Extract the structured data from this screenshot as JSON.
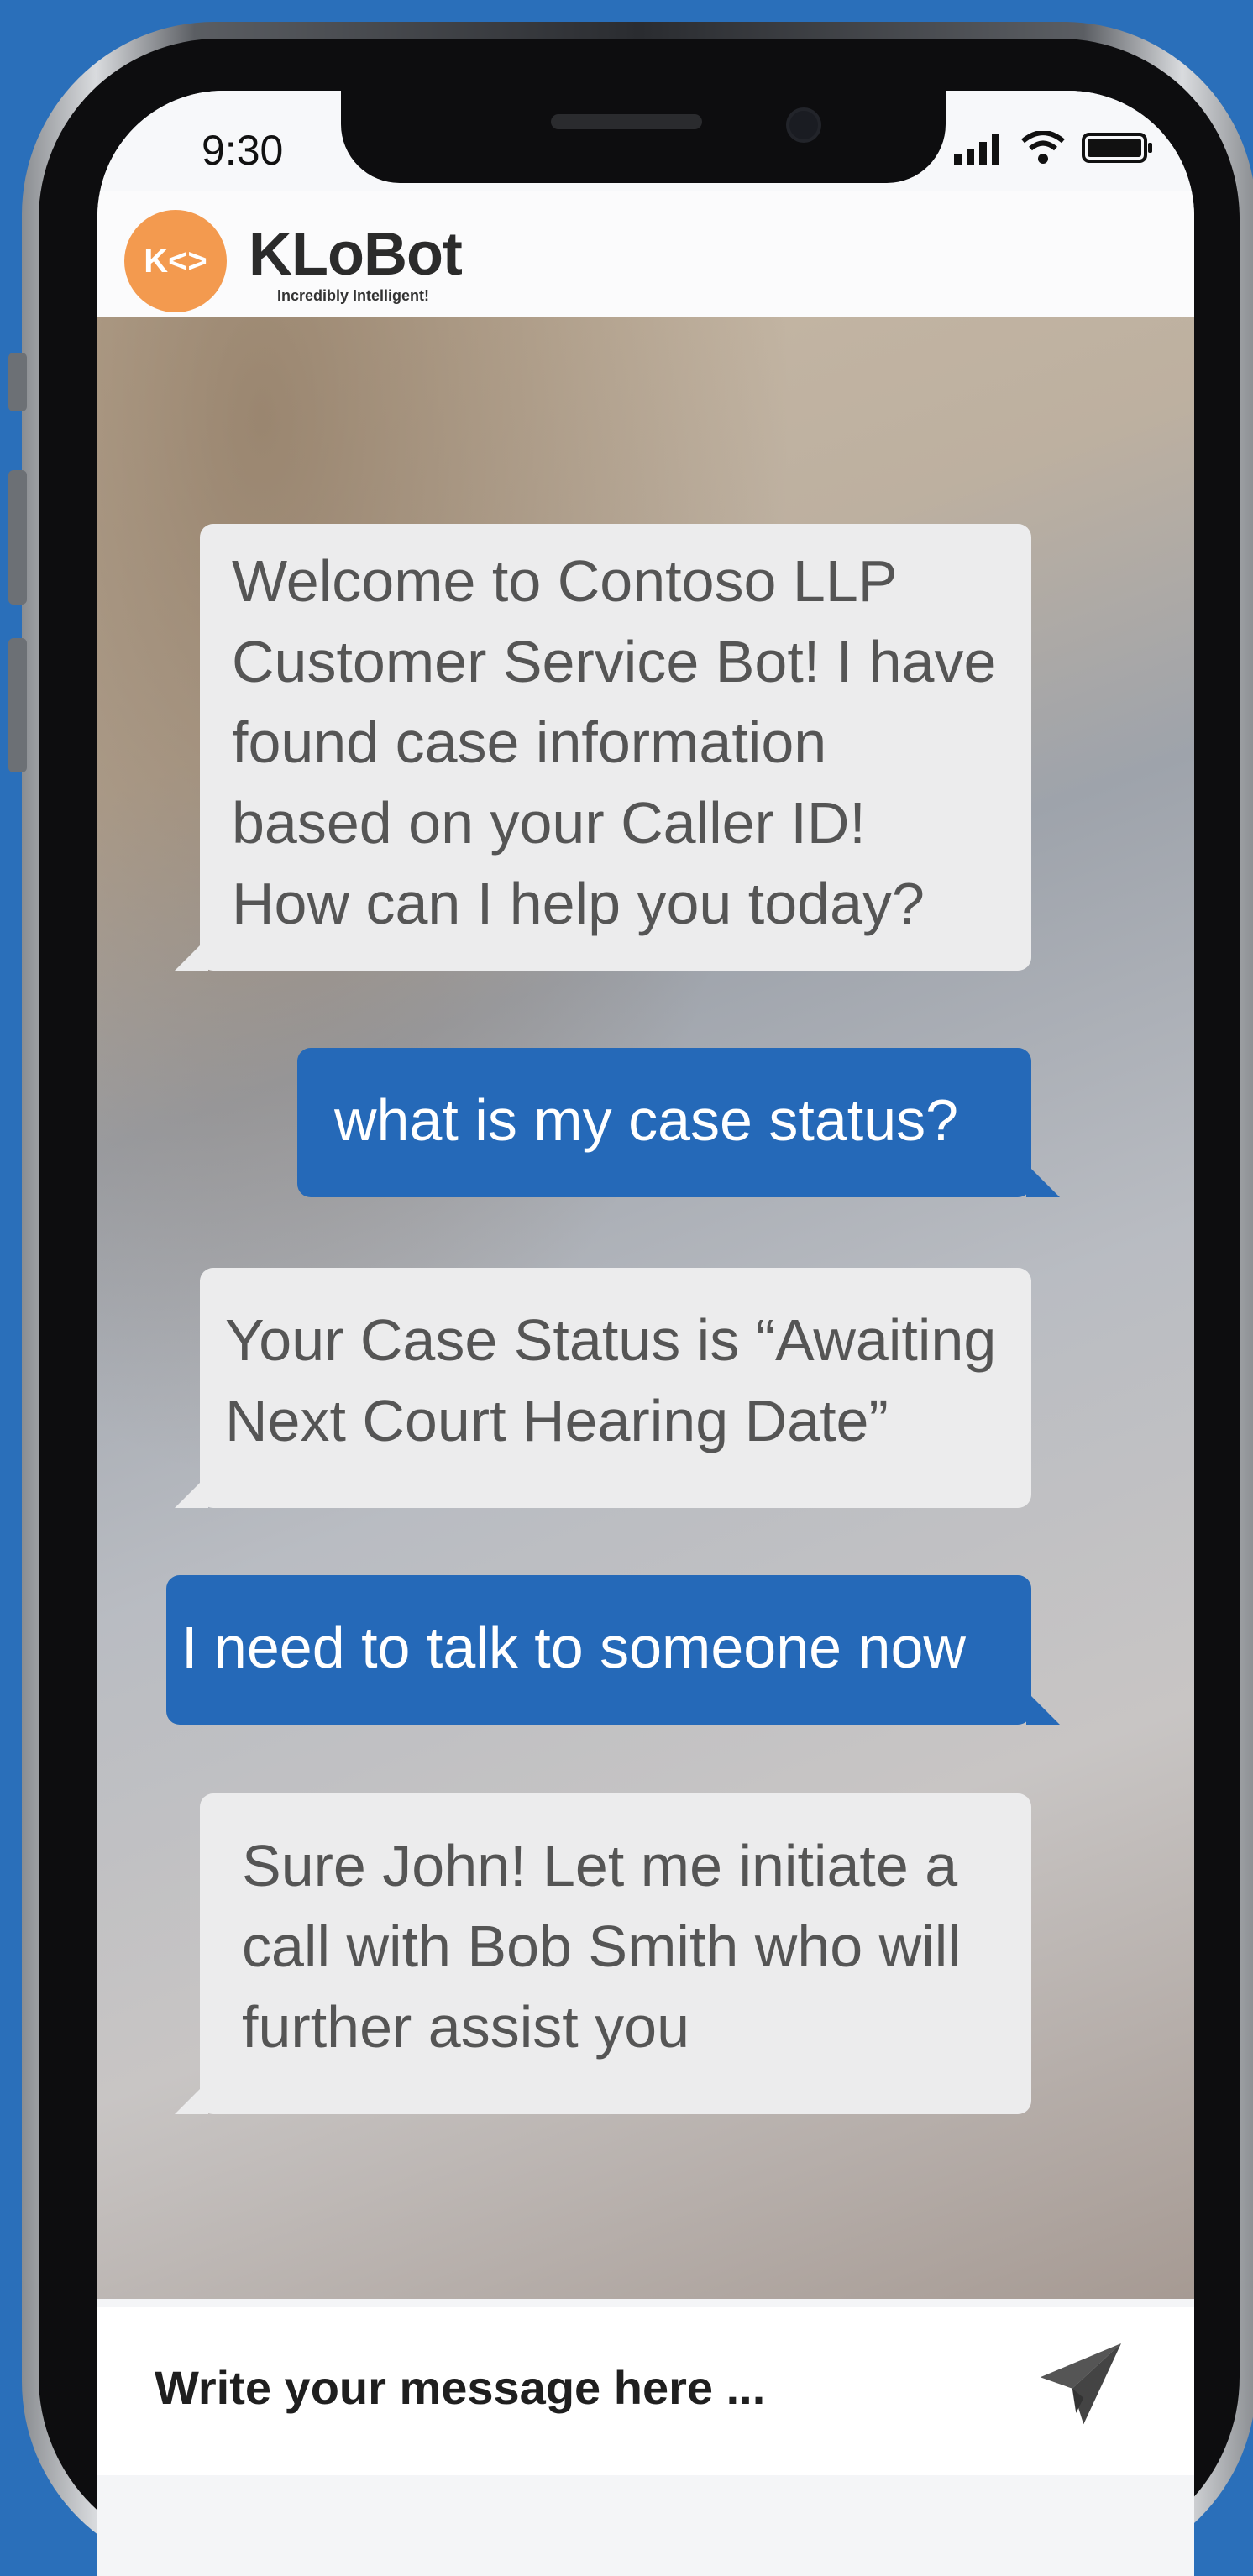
{
  "status_bar": {
    "time": "9:30"
  },
  "header": {
    "brand": "KLoBot",
    "tagline": "Incredibly Intelligent!",
    "logo_text": "K<>"
  },
  "messages": [
    {
      "sender": "bot",
      "text": "Welcome to Contoso LLP Customer Service Bot! I have found case information based on your Caller ID! How can I help you today?"
    },
    {
      "sender": "user",
      "text": "what is my case status?"
    },
    {
      "sender": "bot",
      "text": "Your Case Status is “Awaiting Next Court Hearing Date”"
    },
    {
      "sender": "user",
      "text": "I need to talk to someone now"
    },
    {
      "sender": "bot",
      "text": "Sure John! Let me initiate a call with Bob Smith who will further assist you"
    }
  ],
  "composer": {
    "placeholder": "Write your message here ..."
  },
  "colors": {
    "background": "#2a6fba",
    "user_bubble": "#2569b8",
    "bot_bubble": "#ececed",
    "logo": "#f39a4f"
  }
}
